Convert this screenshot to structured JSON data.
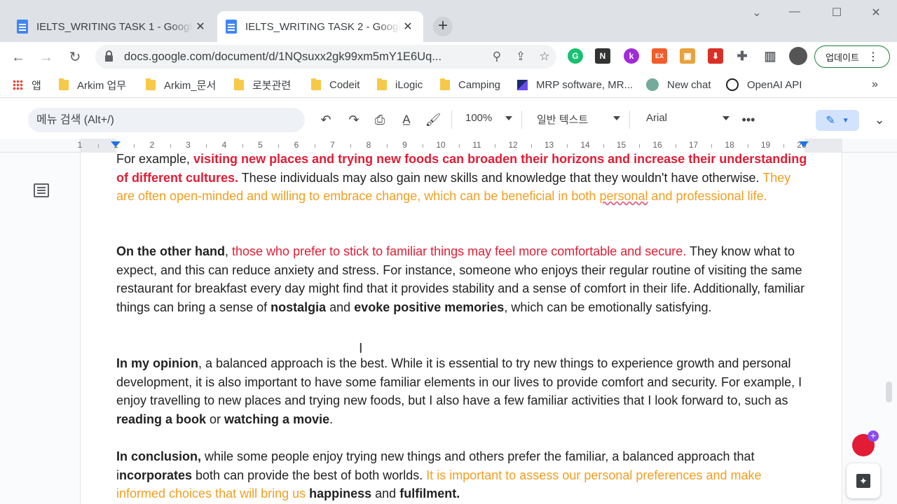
{
  "browser": {
    "tabs": [
      {
        "title": "IELTS_WRITING TASK 1 - Google Docs",
        "active": false
      },
      {
        "title": "IELTS_WRITING TASK 2 - Google Docs",
        "active": true
      }
    ],
    "new_tab_icon": "plus-icon",
    "url": "docs.google.com/document/d/1NQsuxx2gk99xm5mY1E6Uq...",
    "update_label": "업데이트",
    "window_controls": [
      "chevron-down-icon",
      "minimize-icon",
      "maximize-icon",
      "close-icon"
    ]
  },
  "bookmarks": [
    {
      "label": "앱",
      "icon": "apps-grid-icon"
    },
    {
      "label": "Arkim 업무",
      "icon": "folder-icon"
    },
    {
      "label": "Arkim_문서",
      "icon": "folder-icon"
    },
    {
      "label": "로봇관련",
      "icon": "folder-icon"
    },
    {
      "label": "Codeit",
      "icon": "folder-icon"
    },
    {
      "label": "iLogic",
      "icon": "folder-icon"
    },
    {
      "label": "Camping",
      "icon": "folder-icon"
    },
    {
      "label": "MRP software, MR...",
      "icon": "mrp-icon"
    },
    {
      "label": "New chat",
      "icon": "chatgpt-icon"
    },
    {
      "label": "OpenAI API",
      "icon": "openai-icon"
    }
  ],
  "docs_toolbar": {
    "menu_search": "메뉴 검색 (Alt+/)",
    "zoom": "100%",
    "style": "일반 텍스트",
    "font": "Arial"
  },
  "ruler": {
    "numbers": [
      "1",
      "1",
      "2",
      "3",
      "4",
      "5",
      "6",
      "7",
      "8",
      "9",
      "10",
      "11",
      "12",
      "13",
      "14",
      "15",
      "16",
      "17",
      "18",
      "19",
      "20"
    ]
  },
  "document": {
    "p1": {
      "s1": "For example, ",
      "s2": "visiting new places and trying new foods can broaden their horizons and increase their understanding of different cultures.",
      "s3": " These individuals may also gain new skills and knowledge that they wouldn't have otherwise. ",
      "s4": "They are often open-minded and willing to embrace change, which can be beneficial in both ",
      "s5": "personal",
      "s6": " and professional life."
    },
    "p2": {
      "s1": "On the other hand",
      "s2": ", ",
      "s3": "those who prefer to stick to familiar things may feel more comfortable and secure.",
      "s4": " They know what to expect, and this can reduce anxiety and stress. For instance, someone who enjoys their regular routine of visiting the same restaurant for breakfast every day might find that it provides stability and a sense of comfort in their life. Additionally, familiar things can bring a sense of ",
      "s5": "nostalgia",
      "s6": " and ",
      "s7": "evoke positive memories",
      "s8": ", which can be emotionally satisfying."
    },
    "p3": {
      "s1": "In my opinion",
      "s2": ", a balanced approach is the best. While it is essential to try new things to experience growth and personal development, it is also important to have some familiar elements in our lives to provide comfort and security. For example, I enjoy travelling to new places and trying new foods, but I also have a few familiar activities that I look forward to, such as ",
      "s3": "reading a book",
      "s4": " or ",
      "s5": "watching a movie",
      "s6": "."
    },
    "p4": {
      "s1": "In conclusion,",
      "s2": " while some people enjoy trying new things and others prefer the familiar, a balanced approach that i",
      "s3": "ncorporates",
      "s4": " both can provide the best of both worlds. ",
      "s5": "It is important to assess our personal preferences and make informed choices that will bring us ",
      "s6": "happiness",
      "s7": " and ",
      "s8": "fulfilment."
    }
  },
  "colors": {
    "red": "#e21c34",
    "orange": "#f29e1f",
    "accent": "#1a73e8"
  }
}
